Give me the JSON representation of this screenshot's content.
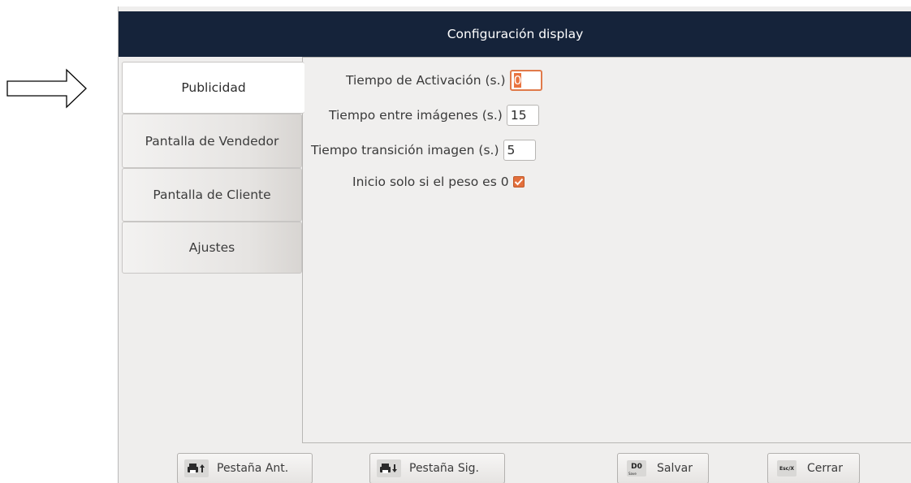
{
  "window": {
    "title": "Configuración display"
  },
  "tabs": [
    {
      "label": "Publicidad",
      "active": true
    },
    {
      "label": "Pantalla de Vendedor",
      "active": false
    },
    {
      "label": "Pantalla de Cliente",
      "active": false
    },
    {
      "label": "Ajustes",
      "active": false
    }
  ],
  "form": {
    "activation_time": {
      "label": "Tiempo de Activación (s.)",
      "value": "0"
    },
    "time_between_images": {
      "label": "Tiempo entre imágenes (s.)",
      "value": "15"
    },
    "image_transition_time": {
      "label": "Tiempo transición imagen (s.)",
      "value": "5"
    },
    "start_only_if_zero_weight": {
      "label": "Inicio solo si el peso es 0",
      "checked": true
    }
  },
  "footer": {
    "prev_tab": {
      "label": "Pestaña Ant.",
      "icon": "printer-up-icon"
    },
    "next_tab": {
      "label": "Pestaña Sig.",
      "icon": "printer-down-icon"
    },
    "save": {
      "label": "Salvar",
      "key": "D0",
      "key_sub": "Save"
    },
    "close": {
      "label": "Cerrar",
      "key": "Esc/X"
    }
  },
  "colors": {
    "titlebar": "#15233a",
    "accent": "#e36f3c"
  }
}
